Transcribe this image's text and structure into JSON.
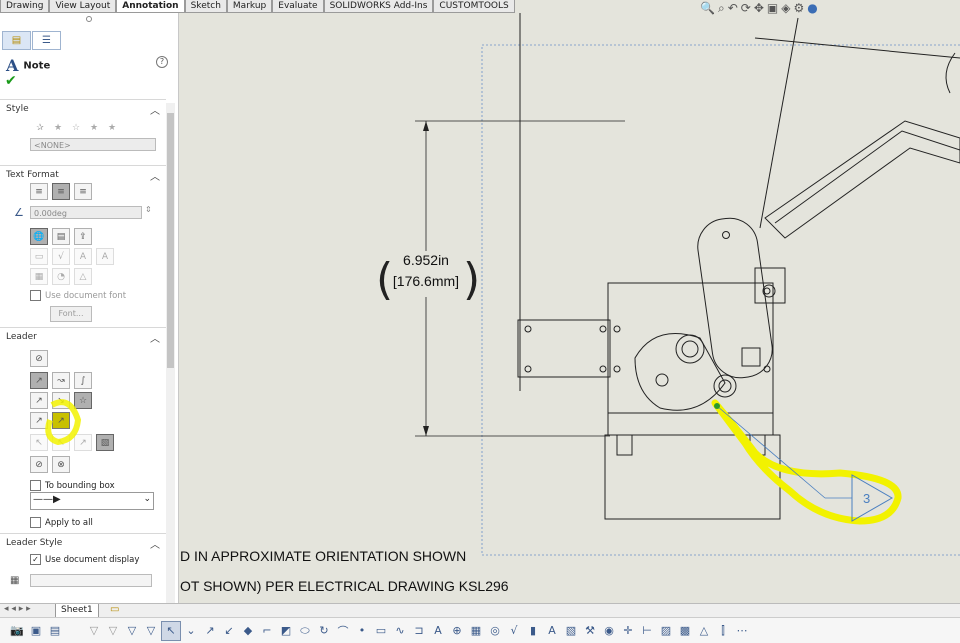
{
  "tabs": [
    "Drawing",
    "View Layout",
    "Annotation",
    "Sketch",
    "Markup",
    "Evaluate",
    "SOLIDWORKS Add-Ins",
    "CUSTOMTOOLS"
  ],
  "active_tab": "Annotation",
  "panel": {
    "title": "Note",
    "style": {
      "title": "Style",
      "dropdown": "<NONE>"
    },
    "text_format": {
      "title": "Text Format",
      "angle": "0.00deg",
      "use_doc_font": "Use document font",
      "font_button": "Font..."
    },
    "leader": {
      "title": "Leader",
      "to_bounding_box": "To bounding box",
      "apply_to_all": "Apply to all"
    },
    "leader_style": {
      "title": "Leader Style",
      "use_doc_display": "Use document display"
    }
  },
  "drawing": {
    "dim_inch": "6.952in",
    "dim_mm": "[176.6mm]",
    "balloon": "3",
    "note_line1": "D IN APPROXIMATE ORIENTATION SHOWN",
    "note_line2": "OT SHOWN) PER ELECTRICAL DRAWING KSL296"
  },
  "sheet_tab": "Sheet1",
  "highlight_color": "#f2f200"
}
